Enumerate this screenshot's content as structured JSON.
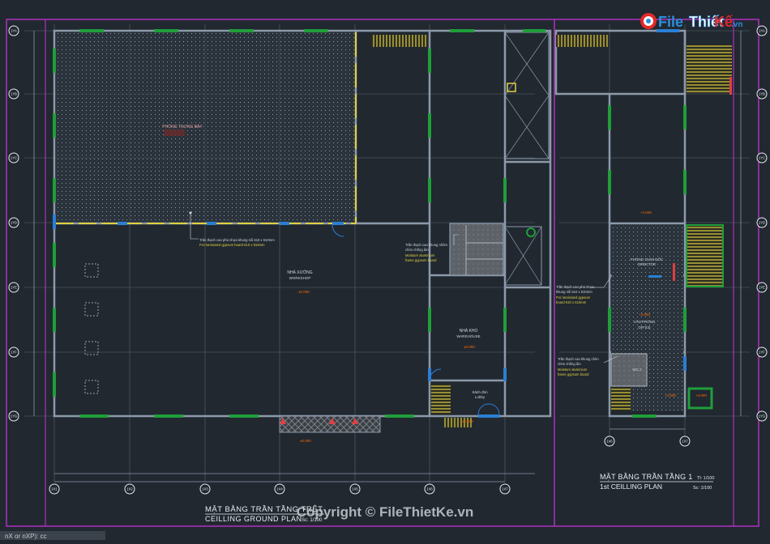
{
  "watermark_logo": {
    "prefix": "File",
    "word1": "Thiết",
    "word2": "Kế",
    "suffix": ".vn"
  },
  "ground_plan": {
    "title_vi": "MẶT BẰNG TRẦN TẦNG TRỆT",
    "title_en": "CEILLING GROUND PLAN",
    "scale": "Sc: 1/100",
    "grid_bottom": [
      "1X1",
      "1X2",
      "1X3",
      "1X4",
      "1X5",
      "1X6",
      "1X7"
    ],
    "grid_left": [
      "1YA",
      "1YB",
      "1YC",
      "1YD",
      "1YE",
      "1YF",
      "1YG"
    ],
    "rooms": {
      "showroom": "PHÒNG TRƯNG BÀY",
      "workshop": "NHÀ XƯỞNG",
      "workshop_en": "WORKSHOP",
      "warehouse": "NHÀ KHO",
      "warehouse_en": "WAREHOUSE",
      "lobby": "Sảnh đón",
      "lobby_en": "Lobby"
    },
    "notes": {
      "showroom_ceiling_vi": "Trần thạch cao phủ nhựa khung nổi 610 x 610mm",
      "showroom_ceiling_en": "Pvc laminated gypsum board 610 x 610mm",
      "wc_ceiling_vi_1": "Trần thạch cao khung nhôm",
      "wc_ceiling_vi_2": "chìm chống ẩm",
      "wc_ceiling_en_1": "Moisture aluminium",
      "wc_ceiling_en_2": "frame gypsum board"
    },
    "level_tag": "±0.000"
  },
  "first_plan": {
    "title_vi": "MẶT BẰNG TRẦN TẦNG 1",
    "title_en": "1st CEILLING PLAN",
    "scale_tl": "Tl: 1/100",
    "scale": "Sc: 1/100",
    "grid_bottom": [
      "1X6",
      "1X7"
    ],
    "rooms": {
      "director": "PHÒNG GIÁM ĐỐC",
      "director_en": "DIRECTOR",
      "office": "VĂN PHÒNG",
      "office_en": "OFFICE",
      "wc": "WC 2"
    },
    "notes": {
      "office_ceiling_vi_1": "Trần thạch cao phủ nhựa",
      "office_ceiling_vi_2": "khung nổi 610 x 610mm",
      "office_ceiling_en_1": "Pvc laminated gypsum",
      "office_ceiling_en_2": "board 610 x 610mm",
      "wc_ceiling_vi_1": "Trần thạch cao khung chìm",
      "wc_ceiling_vi_2": "chìm chống ẩm",
      "wc_ceiling_en_1": "Moisture aluminium",
      "wc_ceiling_en_2": "frame gypsum board"
    },
    "level_tag": "+4.000"
  },
  "footer": {
    "copyright": "Copyright © FileThietKe.vn",
    "command_line": "nX or nXP): cc"
  },
  "colors": {
    "background": "#212830",
    "frame": "#b030c0",
    "wall": "#8c9aaa",
    "window": "#1f9e3a",
    "door": "#2a7fd4",
    "hatch_line": "#e0d040",
    "room_tag": "#ff6a00",
    "note_text": "#d0d8e0",
    "note_text_en": "#e0d040",
    "watermark_blue": "#2a8fe0",
    "watermark_red": "#e02a2a"
  }
}
